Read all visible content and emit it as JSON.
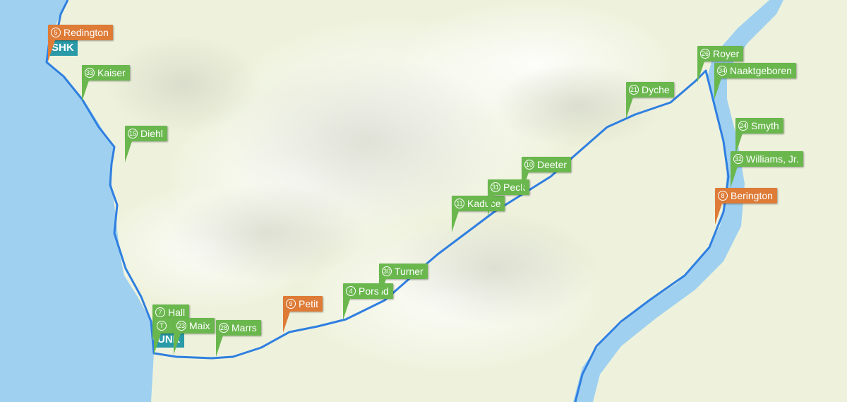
{
  "colors": {
    "water": "#9fd0f0",
    "land": "#eef2dc",
    "route": "#2f7fe0",
    "marker_green": "#6ab74e",
    "marker_orange": "#dd7b37",
    "airport": "#2a9aa8"
  },
  "airports": [
    {
      "id": "shk",
      "code": "SHK"
    },
    {
      "id": "unk",
      "code": "UNK"
    }
  ],
  "markers": [
    {
      "id": "m5",
      "num": "5",
      "name": "Redington",
      "color": "orange"
    },
    {
      "id": "m33",
      "num": "33",
      "name": "Kaiser",
      "color": "green"
    },
    {
      "id": "m15",
      "num": "15",
      "name": "Diehl",
      "color": "green"
    },
    {
      "id": "m7",
      "num": "7",
      "name": "Hall",
      "color": "green"
    },
    {
      "id": "mT",
      "num": "T",
      "name": "",
      "color": "green"
    },
    {
      "id": "m23",
      "num": "23",
      "name": "Maix",
      "color": "green"
    },
    {
      "id": "m28",
      "num": "28",
      "name": "Marrs",
      "color": "green"
    },
    {
      "id": "m9",
      "num": "9",
      "name": "Petit",
      "color": "orange"
    },
    {
      "id": "m4",
      "num": "4",
      "name": "Porsild",
      "color": "green"
    },
    {
      "id": "m30",
      "num": "30",
      "name": "Turner",
      "color": "green"
    },
    {
      "id": "m11",
      "num": "11",
      "name": "Kaduce",
      "color": "green"
    },
    {
      "id": "m31",
      "num": "31",
      "name": "Peck",
      "color": "green"
    },
    {
      "id": "m10",
      "num": "10",
      "name": "Deeter",
      "color": "green"
    },
    {
      "id": "m21",
      "num": "21",
      "name": "Dyche",
      "color": "green"
    },
    {
      "id": "m26",
      "num": "26",
      "name": "Royer",
      "color": "green"
    },
    {
      "id": "m34",
      "num": "34",
      "name": "Naaktgeboren",
      "color": "green"
    },
    {
      "id": "m24",
      "num": "24",
      "name": "Smyth",
      "color": "green"
    },
    {
      "id": "m32",
      "num": "32",
      "name": "Williams, Jr.",
      "color": "green"
    },
    {
      "id": "m8",
      "num": "8",
      "name": "Berington",
      "color": "orange"
    }
  ]
}
